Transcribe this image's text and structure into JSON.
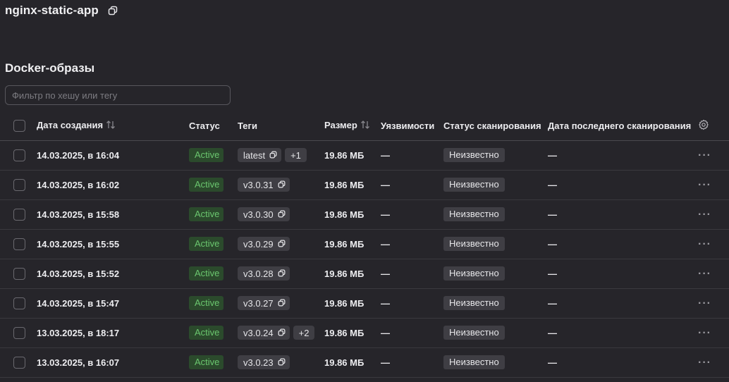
{
  "app": {
    "title": "nginx-static-app"
  },
  "section": {
    "title": "Docker-образы"
  },
  "filter": {
    "placeholder": "Фильтр по хешу или тегу",
    "value": ""
  },
  "table": {
    "columns": {
      "created": "Дата создания",
      "status": "Статус",
      "tags": "Теги",
      "size": "Размер",
      "vulns": "Уязвимости",
      "scan_status": "Статус сканирования",
      "last_scan": "Дата последнего сканирования"
    },
    "rows": [
      {
        "created": "14.03.2025, в 16:04",
        "status": "Active",
        "tag": "latest",
        "more": "+1",
        "size": "19.86 МБ",
        "vulns": "—",
        "scan_status": "Неизвестно",
        "last_scan": "—",
        "actions": "···"
      },
      {
        "created": "14.03.2025, в 16:02",
        "status": "Active",
        "tag": "v3.0.31",
        "more": "",
        "size": "19.86 МБ",
        "vulns": "—",
        "scan_status": "Неизвестно",
        "last_scan": "—",
        "actions": "···"
      },
      {
        "created": "14.03.2025, в 15:58",
        "status": "Active",
        "tag": "v3.0.30",
        "more": "",
        "size": "19.86 МБ",
        "vulns": "—",
        "scan_status": "Неизвестно",
        "last_scan": "—",
        "actions": "···"
      },
      {
        "created": "14.03.2025, в 15:55",
        "status": "Active",
        "tag": "v3.0.29",
        "more": "",
        "size": "19.86 МБ",
        "vulns": "—",
        "scan_status": "Неизвестно",
        "last_scan": "—",
        "actions": "···"
      },
      {
        "created": "14.03.2025, в 15:52",
        "status": "Active",
        "tag": "v3.0.28",
        "more": "",
        "size": "19.86 МБ",
        "vulns": "—",
        "scan_status": "Неизвестно",
        "last_scan": "—",
        "actions": "···"
      },
      {
        "created": "14.03.2025, в 15:47",
        "status": "Active",
        "tag": "v3.0.27",
        "more": "",
        "size": "19.86 МБ",
        "vulns": "—",
        "scan_status": "Неизвестно",
        "last_scan": "—",
        "actions": "···"
      },
      {
        "created": "13.03.2025, в 18:17",
        "status": "Active",
        "tag": "v3.0.24",
        "more": "+2",
        "size": "19.86 МБ",
        "vulns": "—",
        "scan_status": "Неизвестно",
        "last_scan": "—",
        "actions": "···"
      },
      {
        "created": "13.03.2025, в 16:07",
        "status": "Active",
        "tag": "v3.0.23",
        "more": "",
        "size": "19.86 МБ",
        "vulns": "—",
        "scan_status": "Неизвестно",
        "last_scan": "—",
        "actions": "···"
      }
    ]
  },
  "icons": {
    "copy": "copy-icon",
    "sort": "sort-icon",
    "settings": "gear-icon",
    "more": "more-horizontal-icon"
  },
  "colors": {
    "background": "#26252a",
    "active_bg": "#2b4a2c",
    "active_text": "#6bc76f",
    "tag_bg": "#3f3e44"
  }
}
